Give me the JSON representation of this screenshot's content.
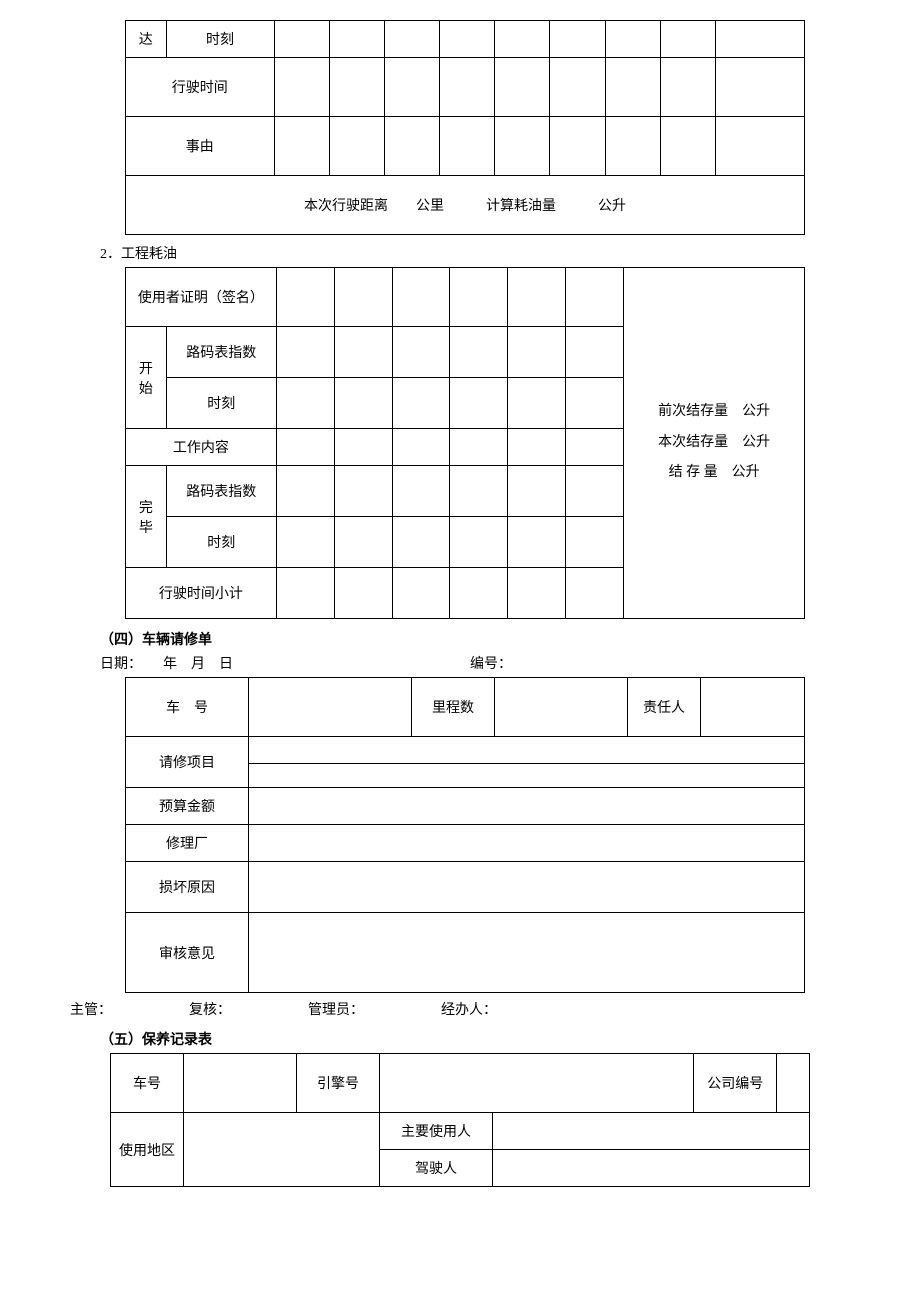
{
  "table1": {
    "da": "达",
    "shike": "时刻",
    "xingshi_shijian": "行驶时间",
    "shiyou": "事由",
    "summary": "本次行驶距离　　公里　　　计算耗油量　　　公升"
  },
  "section2": {
    "label": "2．工程耗油"
  },
  "table2": {
    "user_sign": "使用者证明（签名）",
    "kaishi": "开始",
    "wanbi": "完毕",
    "luma_zhishu": "路码表指数",
    "shike": "时刻",
    "gongzuo_neirong": "工作内容",
    "xingshi_xiaoji": "行驶时间小计",
    "prev_stock": "前次结存量　公升",
    "this_stock": "本次结存量　公升",
    "balance": "结 存 量　公升"
  },
  "section3": {
    "heading": "（四）车辆请修单",
    "date_line": "日期：　　年　月　日",
    "bianhao": "编号：",
    "chehao": "车　号",
    "lichengshu": "里程数",
    "zerenren": "责任人",
    "qingxiu_xiangmu": "请修项目",
    "yusuan_jine": "预算金额",
    "xiulichang": "修理厂",
    "sunhuai_yuanyin": "损坏原因",
    "shenhe_yijian": "审核意见",
    "signer_zhuguan": "主管：",
    "signer_fuhe": "复核：",
    "signer_guanliyuan": "管理员：",
    "signer_jingbanren": "经办人："
  },
  "section4": {
    "heading": "（五）保养记录表",
    "chehao": "车号",
    "yinqinghao": "引擎号",
    "gongsi_bianhao": "公司编号",
    "shiyong_diqu": "使用地区",
    "zhuyao_shiyongren": "主要使用人",
    "jiashiren": "驾驶人"
  }
}
